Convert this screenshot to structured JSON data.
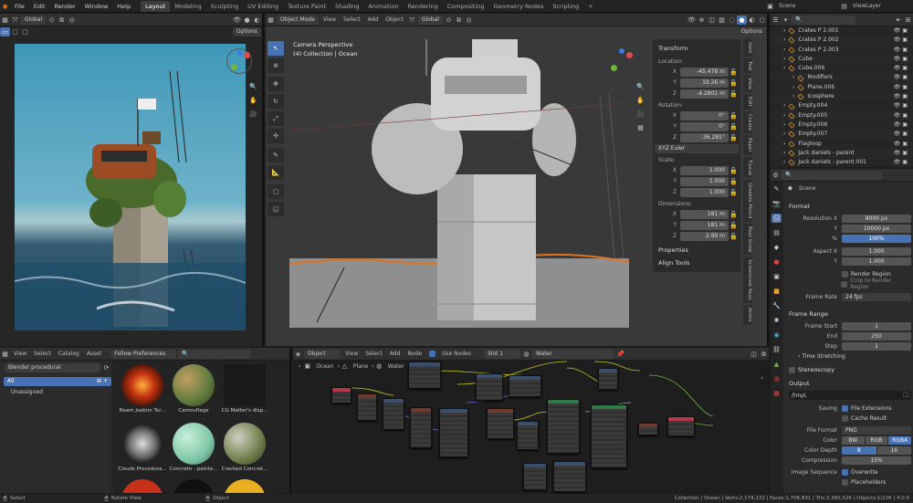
{
  "menu": [
    "File",
    "Edit",
    "Render",
    "Window",
    "Help"
  ],
  "workspaces": [
    "Layout",
    "Modeling",
    "Sculpting",
    "UV Editing",
    "Texture Paint",
    "Shading",
    "Animation",
    "Rendering",
    "Compositing",
    "Geometry Nodes",
    "Scripting"
  ],
  "active_workspace": "Layout",
  "add_tab": "+",
  "scene_name": "Scene",
  "view_layer": "ViewLayer",
  "left_view": {
    "transform_orientation": "Global",
    "options_label": "Options"
  },
  "viewport": {
    "mode": "Object Mode",
    "menus": [
      "View",
      "Select",
      "Add",
      "Object"
    ],
    "orientation": "Global",
    "options_label": "Options",
    "camera_label": "Camera Perspective",
    "collection_label": "(4) Collection | Ocean",
    "transform": {
      "title": "Transform",
      "location_label": "Location:",
      "location": [
        {
          "k": "X",
          "v": "-45.478 m"
        },
        {
          "k": "Y",
          "v": "19.26 m"
        },
        {
          "k": "Z",
          "v": "-4.2802 m"
        }
      ],
      "rotation_label": "Rotation:",
      "rotation": [
        {
          "k": "X",
          "v": "0°"
        },
        {
          "k": "Y",
          "v": "0°"
        },
        {
          "k": "Z",
          "v": "-36.281°"
        }
      ],
      "rotation_mode": "XYZ Euler",
      "scale_label": "Scale:",
      "scale": [
        {
          "k": "X",
          "v": "1.000"
        },
        {
          "k": "Y",
          "v": "1.000"
        },
        {
          "k": "Z",
          "v": "1.000"
        }
      ],
      "dimensions_label": "Dimensions:",
      "dimensions": [
        {
          "k": "X",
          "v": "181 m"
        },
        {
          "k": "Y",
          "v": "181 m"
        },
        {
          "k": "Z",
          "v": "2.99 m"
        }
      ],
      "properties_label": "Properties",
      "align_tools_label": "Align Tools"
    },
    "side_tabs": [
      "Item",
      "Tool",
      "View",
      "Edit",
      "Create",
      "Paper",
      "Tissue",
      "Greeble Pencil",
      "Real Snow",
      "Screencast Keys",
      "Animi"
    ]
  },
  "outliner": {
    "items": [
      {
        "name": "Crates P 2.001",
        "indent": 0
      },
      {
        "name": "Crates P 2.002",
        "indent": 0
      },
      {
        "name": "Crates P 2.003",
        "indent": 0
      },
      {
        "name": "Cube",
        "indent": 0
      },
      {
        "name": "Cube.006",
        "indent": 0
      },
      {
        "name": "Modifiers",
        "indent": 1
      },
      {
        "name": "Plane.006",
        "indent": 1
      },
      {
        "name": "Icosphere",
        "indent": 1
      },
      {
        "name": "Empty.004",
        "indent": 0
      },
      {
        "name": "Empty.005",
        "indent": 0
      },
      {
        "name": "Empty.006",
        "indent": 0
      },
      {
        "name": "Empty.007",
        "indent": 0
      },
      {
        "name": "Flagloop",
        "indent": 0
      },
      {
        "name": "Jack daniels - parent",
        "indent": 0
      },
      {
        "name": "Jack daniels - parent.001",
        "indent": 0
      }
    ]
  },
  "properties": {
    "scene_label": "Scene",
    "format": {
      "title": "Format",
      "resolution_x_label": "Resolution X",
      "resolution_x": "8000 px",
      "y_label": "Y",
      "resolution_y": "10000 px",
      "percent_label": "%",
      "percent": "100%",
      "aspect_x_label": "Aspect X",
      "aspect_x": "1.000",
      "aspect_y_label": "Y",
      "aspect_y": "1.000",
      "render_region": "Render Region",
      "crop_region": "Crop to Render Region",
      "frame_rate_label": "Frame Rate",
      "frame_rate": "24 fps"
    },
    "frame_range": {
      "title": "Frame Range",
      "start_label": "Frame Start",
      "start": "1",
      "end_label": "End",
      "end": "250",
      "step_label": "Step",
      "step": "1",
      "time_stretching": "Time Stretching"
    },
    "stereoscopy": "Stereoscopy",
    "output": {
      "title": "Output",
      "path": "/tmp\\",
      "saving_label": "Saving",
      "file_extensions": "File Extensions",
      "cache_result": "Cache Result",
      "file_format_label": "File Format",
      "file_format": "PNG",
      "color_label": "Color",
      "color_opts": [
        "BW",
        "RGB",
        "RGBA"
      ],
      "color_depth_label": "Color Depth",
      "color_depth_opts": [
        "8",
        "16"
      ],
      "compression_label": "Compression",
      "compression": "15%",
      "image_sequence_label": "Image Sequence",
      "overwrite": "Overwrite",
      "placeholders": "Placeholders"
    }
  },
  "asset_browser": {
    "menus": [
      "View",
      "Select",
      "Catalog",
      "Asset"
    ],
    "follow": "Follow Preferences",
    "library": "Blender procedural",
    "catalogs": [
      "All",
      "Unassigned"
    ],
    "assets": [
      {
        "name": "Beam Joakim Tor...",
        "color": "#c2320f"
      },
      {
        "name": "Camouflage",
        "color": "#5e7a3e"
      },
      {
        "name": "CG Matter's disp...",
        "color": "#1a1a1a"
      },
      {
        "name": "Clouds Procedura...",
        "color": "#777777"
      },
      {
        "name": "Concrete - painte...",
        "color": "#7fc6a6"
      },
      {
        "name": "Cracked Concret...",
        "color": "#6d7d4a"
      }
    ]
  },
  "node_editor": {
    "object_menu": "Object",
    "menus": [
      "View",
      "Select",
      "Add",
      "Node"
    ],
    "use_nodes": "Use Nodes",
    "slot": "Slot 1",
    "material": "Water",
    "breadcrumb": [
      "Ocean",
      "Plane",
      "Water"
    ]
  },
  "status": {
    "select": "Select",
    "rotate": "Rotate View",
    "object": "Object",
    "stats": "Collection | Ocean | Verts:2,174,132 | Faces:1,706,831 | Tris:3,360,526 | Objects:1/226 | 4.0.0"
  },
  "colors": {
    "accent": "#4772b3",
    "header": "#303030",
    "bg": "#1d1d1d"
  }
}
